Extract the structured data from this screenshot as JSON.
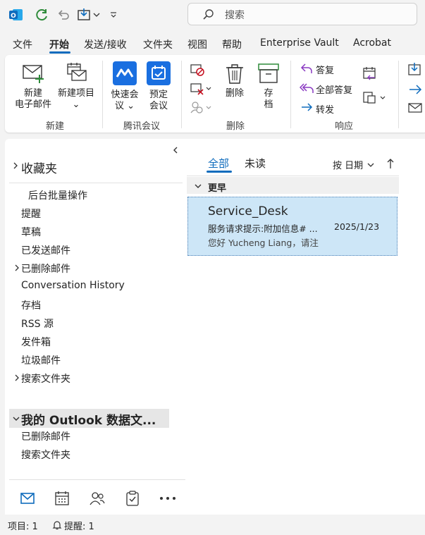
{
  "search": {
    "placeholder": "搜索"
  },
  "tabs": [
    "文件",
    "开始",
    "发送/接收",
    "文件夹",
    "视图",
    "帮助",
    "Enterprise Vault",
    "Acrobat"
  ],
  "ribbon": {
    "new_email": [
      "新建",
      "电子邮件"
    ],
    "new_item": [
      "新建项目",
      "⌄"
    ],
    "quick_meeting": [
      "快速会",
      "议 ⌄"
    ],
    "schedule_meeting": [
      "预定",
      "会议"
    ],
    "delete": "删除",
    "archive": [
      "存",
      "档"
    ],
    "reply": "答复",
    "reply_all": "全部答复",
    "forward": "转发",
    "groups": {
      "new": "新建",
      "tencent": "腾讯会议",
      "delete": "删除",
      "respond": "响应"
    }
  },
  "nav": {
    "favorites": "收藏夹",
    "favorites_items": [
      "后台批量操作"
    ],
    "folders": [
      "提醒",
      "草稿",
      "已发送邮件",
      "已删除邮件",
      "Conversation History",
      "存档",
      "RSS 源",
      "发件箱",
      "垃圾邮件",
      "搜索文件夹"
    ],
    "data_file": "我的 Outlook 数据文...",
    "data_file_items": [
      "已删除邮件",
      "搜索文件夹"
    ]
  },
  "list": {
    "filter_all": "全部",
    "filter_unread": "未读",
    "sort": "按 日期",
    "group_header": "更早",
    "messages": [
      {
        "sender": "Service_Desk",
        "subject": "服务请求提示:附加信息# ...",
        "date": "2025/1/23",
        "preview": "您好 Yucheng Liang，请注"
      }
    ]
  },
  "status": {
    "items": "项目: 1",
    "reminders": "提醒: 1"
  },
  "colors": {
    "accent": "#0f6cbd",
    "selected": "#cde6f7",
    "ribbon_bg": "#ffffff",
    "chrome_bg": "#f3f3f3"
  }
}
